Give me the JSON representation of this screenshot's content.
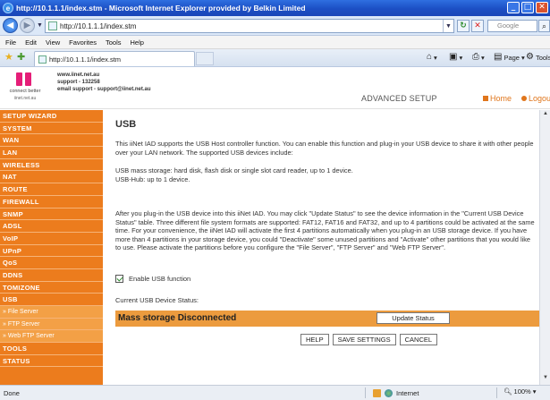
{
  "window": {
    "title": "http://10.1.1.1/index.stm - Microsoft Internet Explorer provided by Belkin Limited",
    "min": "_",
    "max": "□",
    "close": "✕"
  },
  "address": {
    "url": "http://10.1.1.1/index.stm",
    "search_placeholder": "Google"
  },
  "menu": [
    "File",
    "Edit",
    "View",
    "Favorites",
    "Tools",
    "Help"
  ],
  "tab": {
    "title": "http://10.1.1.1/index.stm"
  },
  "commands": {
    "page": "Page",
    "tools": "Tools"
  },
  "header": {
    "logo_tagline": "connect better",
    "logo_domain": "iinet.net.au",
    "contact_site": "www.iinet.net.au",
    "contact_support": "support - 132258",
    "contact_email": "email support - support@iinet.net.au",
    "mode": "ADVANCED SETUP",
    "home": "Home",
    "logout": "Logout"
  },
  "sidebar": {
    "items": [
      {
        "label": "SETUP WIZARD",
        "type": "main"
      },
      {
        "label": "SYSTEM",
        "type": "main"
      },
      {
        "label": "WAN",
        "type": "main"
      },
      {
        "label": "LAN",
        "type": "main"
      },
      {
        "label": "WIRELESS",
        "type": "main"
      },
      {
        "label": "NAT",
        "type": "main"
      },
      {
        "label": "ROUTE",
        "type": "main"
      },
      {
        "label": "FIREWALL",
        "type": "main"
      },
      {
        "label": "SNMP",
        "type": "main"
      },
      {
        "label": "ADSL",
        "type": "main"
      },
      {
        "label": "VoIP",
        "type": "main"
      },
      {
        "label": "UPnP",
        "type": "main"
      },
      {
        "label": "QoS",
        "type": "main"
      },
      {
        "label": "DDNS",
        "type": "main"
      },
      {
        "label": "TOMIZONE",
        "type": "main"
      },
      {
        "label": "USB",
        "type": "main"
      },
      {
        "label": "» File Server",
        "type": "sub"
      },
      {
        "label": "» FTP Server",
        "type": "sub"
      },
      {
        "label": "» Web FTP Server",
        "type": "sub"
      },
      {
        "label": "TOOLS",
        "type": "main"
      },
      {
        "label": "STATUS",
        "type": "main"
      }
    ]
  },
  "content": {
    "title": "USB",
    "para1": "This iiNet IAD supports the USB Host controller function. You can enable this function and plug-in your USB device to share it with other people over your LAN network. The supported USB devices include:",
    "para2a": "USB mass storage: hard disk, flash disk or single slot card reader, up to 1 device.",
    "para2b": "USB-Hub: up to 1 device.",
    "para3": "After you plug-in the USB device into this iiNet IAD. You may click \"Update Status\" to see the device information in the \"Current USB Device Status\" table. Three different file system formats are supported: FAT12, FAT16 and FAT32, and up to 4 partitions could be activated at the same time. For your convenience, the iiNet IAD will activate the first 4 partitions automatically when you plug-in an USB storage device. If you have more than 4 partitions in your storage device, you could \"Deactivate\" some unused partitions and \"Activate\" other partitions that you would like to use. Please activate the partitions before you configure the \"File Server\", \"FTP Server\" and \"Web FTP Server\".",
    "enable_label": "Enable USB function",
    "enable_checked": true,
    "status_label": "Current USB Device Status:",
    "status_text": "Mass storage Disconnected",
    "update_button": "Update Status",
    "help_button": "HELP",
    "save_button": "SAVE SETTINGS",
    "cancel_button": "CANCEL"
  },
  "statusbar": {
    "left": "Done",
    "zone": "Internet",
    "zoom": "100%"
  },
  "colors": {
    "sidebar": "#ec7c1d",
    "sidebar_sub": "#f3a046",
    "status_bar": "#ec9b3e",
    "accent": "#e0761c",
    "logo": "#e51e78"
  }
}
